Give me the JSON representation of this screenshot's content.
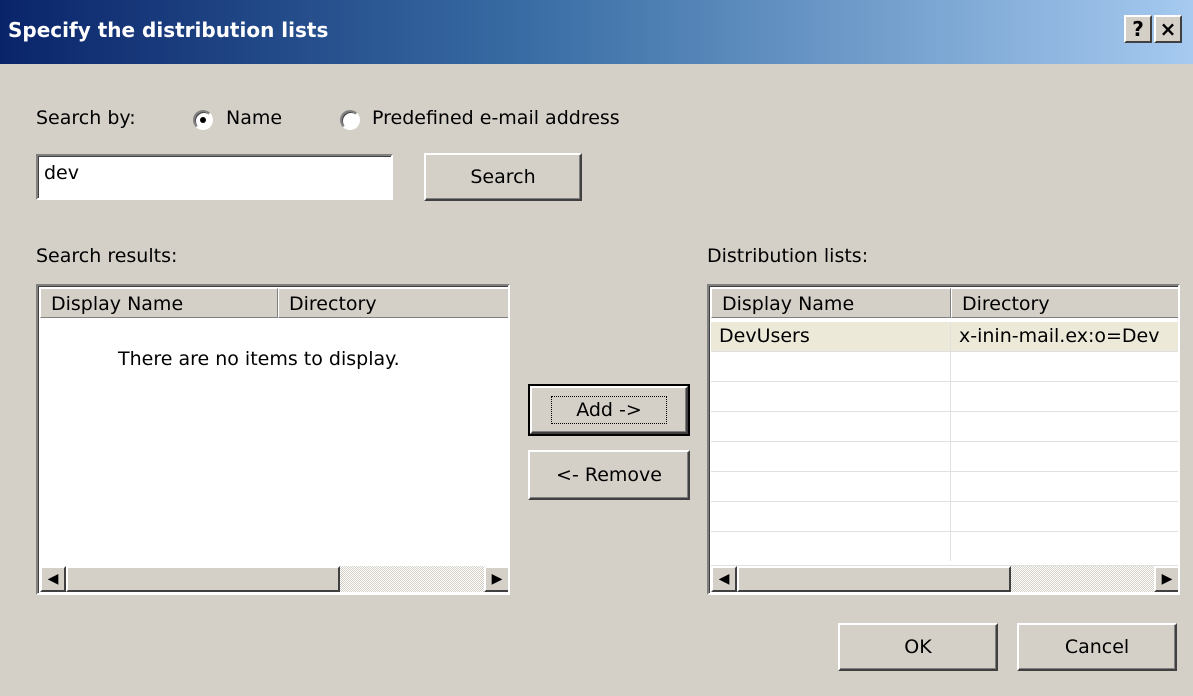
{
  "window": {
    "title": "Specify the distribution lists",
    "help_label": "?",
    "close_label": "×"
  },
  "search": {
    "by_label": "Search by:",
    "option_name": "Name",
    "option_email": "Predefined e-mail address",
    "selected": "Name",
    "query": "dev",
    "button_label": "Search"
  },
  "results": {
    "label": "Search results:",
    "columns": [
      "Display Name",
      "Directory"
    ],
    "empty_text": "There are no items to display."
  },
  "actions": {
    "add_label": "Add ->",
    "remove_label": "<- Remove"
  },
  "distribution": {
    "label": "Distribution lists:",
    "columns": [
      "Display Name",
      "Directory"
    ],
    "rows": [
      {
        "display_name": "DevUsers",
        "directory": "x-inin-mail.ex:o=Dev"
      }
    ]
  },
  "footer": {
    "ok_label": "OK",
    "cancel_label": "Cancel"
  },
  "colors": {
    "title_gradient_start": "#0a246a",
    "title_gradient_end": "#a6caf0",
    "dialog_bg": "#d4d0c8"
  }
}
